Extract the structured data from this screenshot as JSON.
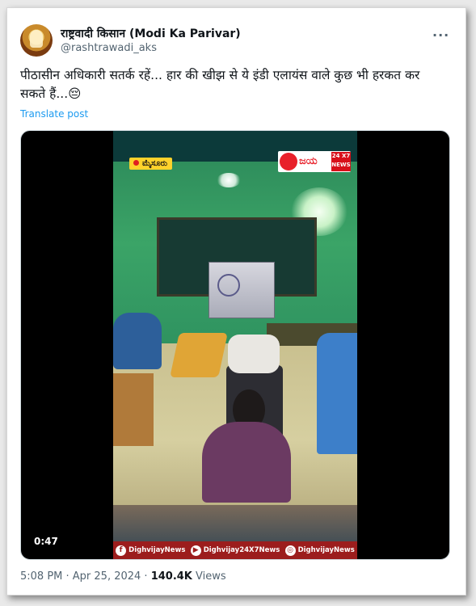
{
  "author": {
    "display_name": "राष्ट्रवादी किसान (Modi Ka Parivar)",
    "handle": "@rashtrawadi_aks"
  },
  "more_icon": "more-horizontal-icon",
  "tweet": {
    "text": "पीठासीन अधिकारी सतर्क रहें... हार की खीझ से ये इंडी एलायंस वाले कुछ भी हरकत कर सकते हैं...😔",
    "translate_label": "Translate post"
  },
  "video": {
    "duration": "0:47",
    "location_tag": "ಮೈಸೂರು",
    "channel_logo_text": "ಜಯ",
    "channel_badge": "24 X7 NEWS",
    "social": [
      {
        "icon": "facebook-icon",
        "glyph": "f",
        "label": "DighvijayNews"
      },
      {
        "icon": "youtube-icon",
        "glyph": "▶",
        "label": "Dighvijay24X7News"
      },
      {
        "icon": "instagram-icon",
        "glyph": "◎",
        "label": "DighvijayNews"
      }
    ]
  },
  "meta": {
    "time_date": "5:08 PM · Apr 25, 2024 · ",
    "views_count": "140.4K",
    "views_label": " Views"
  },
  "colors": {
    "link": "#1d9bf0",
    "secondary_text": "#536471",
    "primary_text": "#0f1419"
  }
}
